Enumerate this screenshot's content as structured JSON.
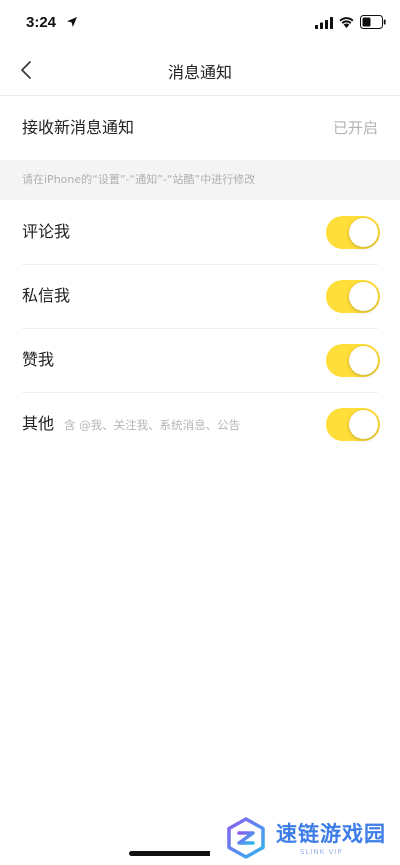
{
  "status_bar": {
    "time": "3:24"
  },
  "nav": {
    "title": "消息通知",
    "back_icon": "chevron-left-icon"
  },
  "receive_row": {
    "label": "接收新消息通知",
    "value": "已开启"
  },
  "hint": {
    "text": "请在iPhone的“设置”-“通知”-“站酷”中进行修改"
  },
  "settings": [
    {
      "label": "评论我",
      "sub": "",
      "enabled": true
    },
    {
      "label": "私信我",
      "sub": "",
      "enabled": true
    },
    {
      "label": "赞我",
      "sub": "",
      "enabled": true
    },
    {
      "label": "其他",
      "sub": "含 @我、关注我、系统消息、公告",
      "enabled": true
    }
  ],
  "colors": {
    "toggle_on": "#ffde3a",
    "watermark_blue": "#3d7de8"
  },
  "watermark": {
    "title": "速链游戏园",
    "subtitle": "SLINK VIP"
  }
}
